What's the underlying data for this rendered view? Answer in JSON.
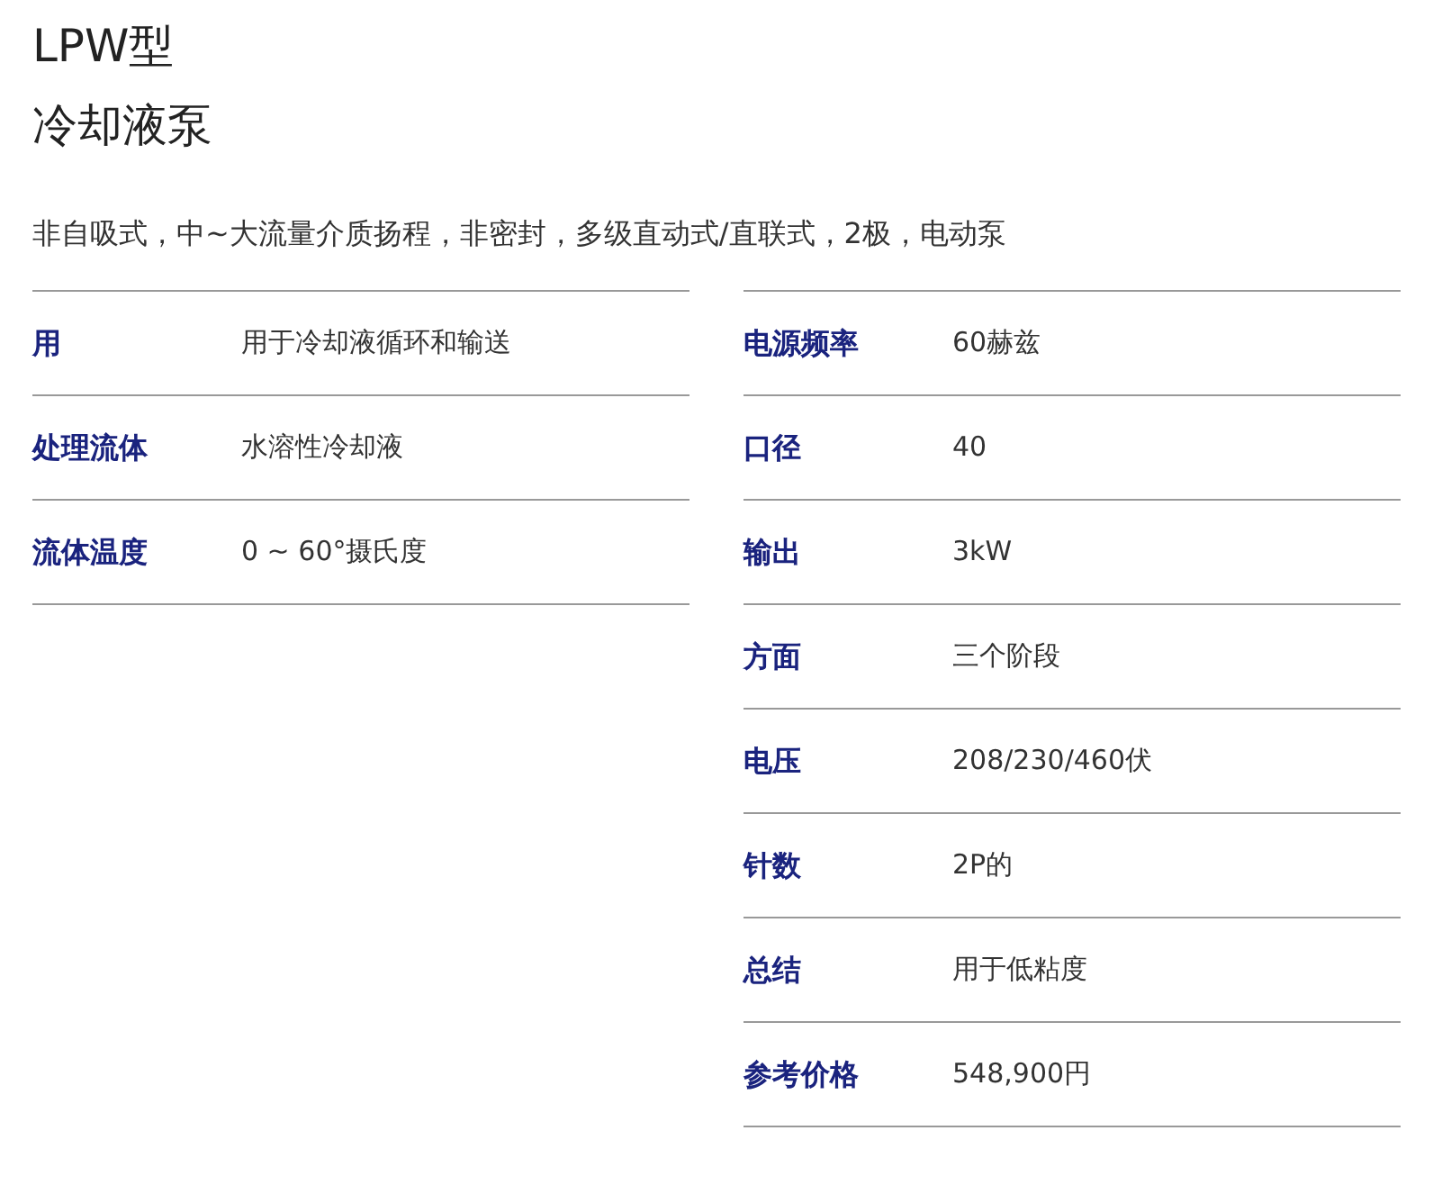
{
  "title": [
    "LPW型",
    "冷却液泵"
  ],
  "description": "非自吸式，中~大流量介质扬程，非密封，多级直动式/直联式，2极，电动泵",
  "left_specs": [
    {
      "label": "用",
      "value": "用于冷却液循环和输送"
    },
    {
      "label": "处理流体",
      "value": "水溶性冷却液"
    },
    {
      "label": "流体温度",
      "value": "0 ~ 60°摄氏度"
    }
  ],
  "right_specs": [
    {
      "label": "电源频率",
      "value": "60赫兹"
    },
    {
      "label": "口径",
      "value": "40"
    },
    {
      "label": "输出",
      "value": "3kW"
    },
    {
      "label": "方面",
      "value": "三个阶段"
    },
    {
      "label": "电压",
      "value": "208/230/460伏"
    },
    {
      "label": "针数",
      "value": "2P的"
    },
    {
      "label": "总结",
      "value": "用于低粘度"
    },
    {
      "label": "参考价格",
      "value": "548,900円"
    }
  ]
}
